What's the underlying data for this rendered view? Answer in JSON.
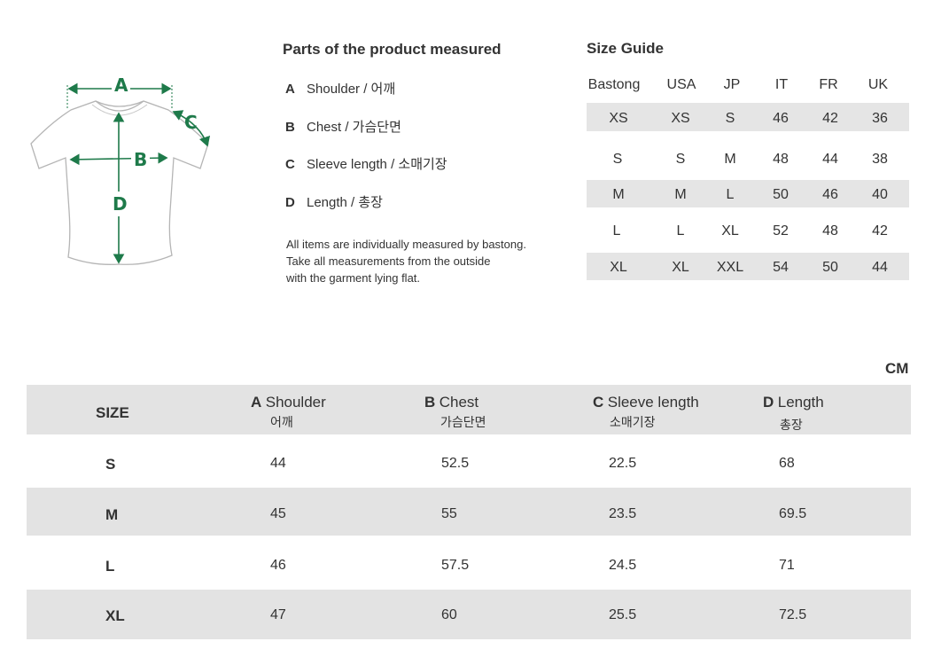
{
  "diagram": {
    "labels": [
      "A",
      "B",
      "C",
      "D"
    ]
  },
  "parts": {
    "title": "Parts of the product measured",
    "items": [
      {
        "letter": "A",
        "label": "Shoulder / 어깨"
      },
      {
        "letter": "B",
        "label": "Chest / 가슴단면"
      },
      {
        "letter": "C",
        "label": "Sleeve length / 소매기장"
      },
      {
        "letter": "D",
        "label": "Length / 총장"
      }
    ],
    "note": [
      "All items are individually measured by bastong.",
      "Take all measurements from the outside",
      "with the garment lying flat."
    ]
  },
  "size_guide": {
    "title": "Size Guide",
    "headers": [
      "Bastong",
      "USA",
      "JP",
      "IT",
      "FR",
      "UK"
    ],
    "rows": [
      [
        "XS",
        "XS",
        "S",
        "46",
        "42",
        "36"
      ],
      [
        "S",
        "S",
        "M",
        "48",
        "44",
        "38"
      ],
      [
        "M",
        "M",
        "L",
        "50",
        "46",
        "40"
      ],
      [
        "L",
        "L",
        "XL",
        "52",
        "48",
        "42"
      ],
      [
        "XL",
        "XL",
        "XXL",
        "54",
        "50",
        "44"
      ]
    ]
  },
  "measure_table": {
    "unit": "CM",
    "size_header": "SIZE",
    "columns": [
      {
        "letter": "A",
        "label": "Shoulder",
        "ko": "어깨"
      },
      {
        "letter": "B",
        "label": "Chest",
        "ko": "가슴단면"
      },
      {
        "letter": "C",
        "label": "Sleeve length",
        "ko": "소매기장"
      },
      {
        "letter": "D",
        "label": "Length",
        "ko": "총장"
      }
    ],
    "rows": [
      {
        "size": "S",
        "values": [
          "44",
          "52.5",
          "22.5",
          "68"
        ]
      },
      {
        "size": "M",
        "values": [
          "45",
          "55",
          "23.5",
          "69.5"
        ]
      },
      {
        "size": "L",
        "values": [
          "46",
          "57.5",
          "24.5",
          "71"
        ]
      },
      {
        "size": "XL",
        "values": [
          "47",
          "60",
          "25.5",
          "72.5"
        ]
      }
    ]
  }
}
